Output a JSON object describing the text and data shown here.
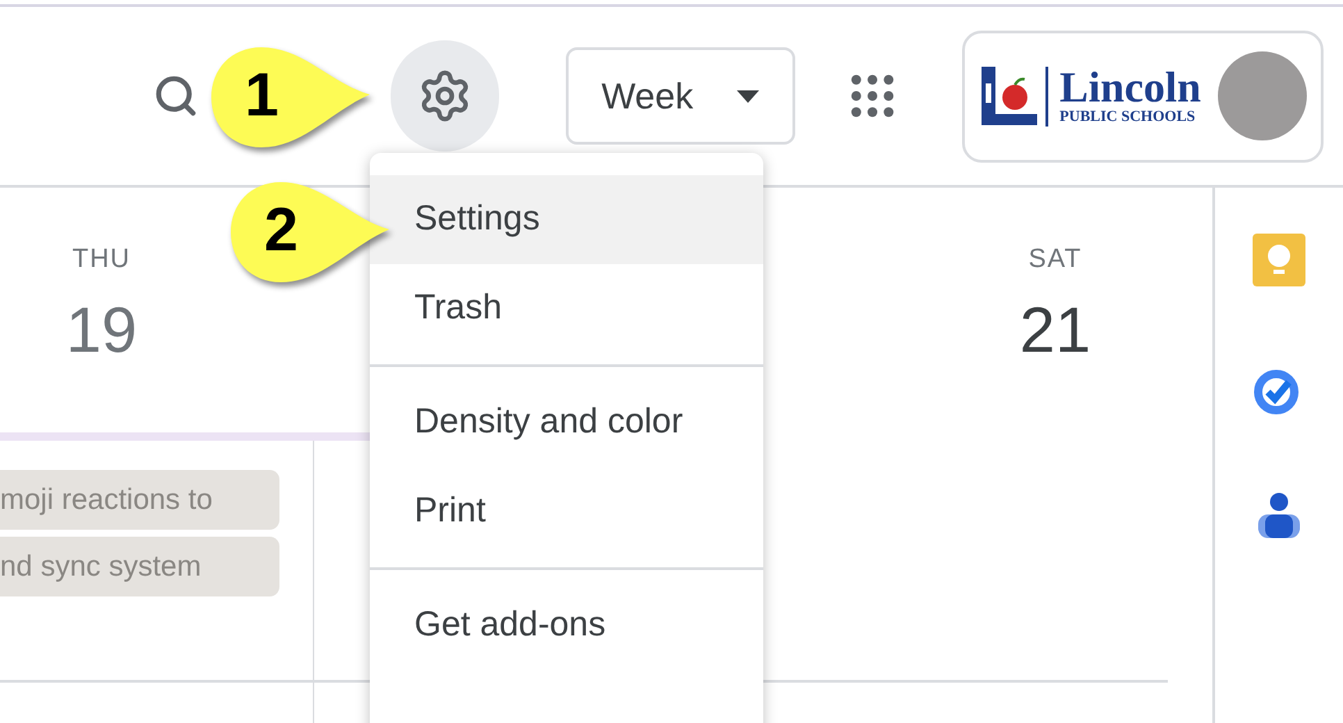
{
  "header": {
    "view_selector": "Week",
    "account": {
      "logo_title": "Lincoln",
      "logo_subtitle": "PUBLIC SCHOOLS"
    }
  },
  "days": [
    {
      "weekday": "THU",
      "date": "19",
      "today": false
    },
    {
      "weekday": "SAT",
      "date": "21",
      "today": true
    }
  ],
  "events": [
    "moji reactions to",
    "nd sync system"
  ],
  "menu": {
    "sections": [
      [
        {
          "label": "Settings",
          "selected": true
        },
        {
          "label": "Trash",
          "selected": false
        }
      ],
      [
        {
          "label": "Density and color",
          "selected": false
        },
        {
          "label": "Print",
          "selected": false
        }
      ],
      [
        {
          "label": "Get add-ons",
          "selected": false
        }
      ]
    ]
  },
  "callouts": [
    "1",
    "2"
  ]
}
